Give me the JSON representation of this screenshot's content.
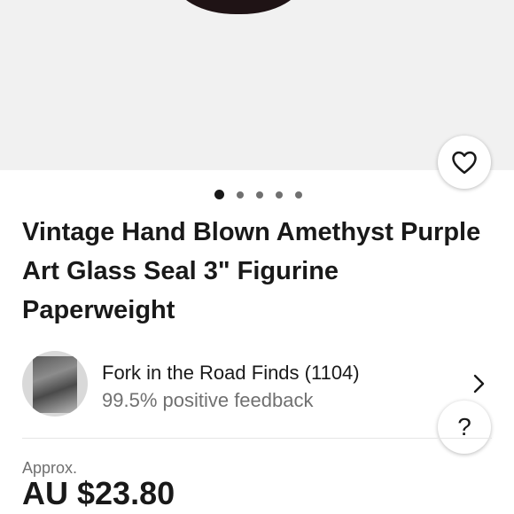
{
  "listing": {
    "title": "Vintage Hand Blown Amethyst Purple Art Glass Seal 3\" Figurine Paperweight",
    "gallery": {
      "image_count": 5,
      "active_index": 0
    }
  },
  "seller": {
    "name_line": "Fork in the Road Finds (1104)",
    "feedback_line": "99.5% positive feedback"
  },
  "help": {
    "label": "?"
  },
  "price": {
    "approx_label": "Approx.",
    "value": "AU $23.80"
  },
  "icons": {
    "favorite": "heart-outline-icon",
    "seller_nav": "chevron-right-icon",
    "help": "question-mark-icon"
  }
}
